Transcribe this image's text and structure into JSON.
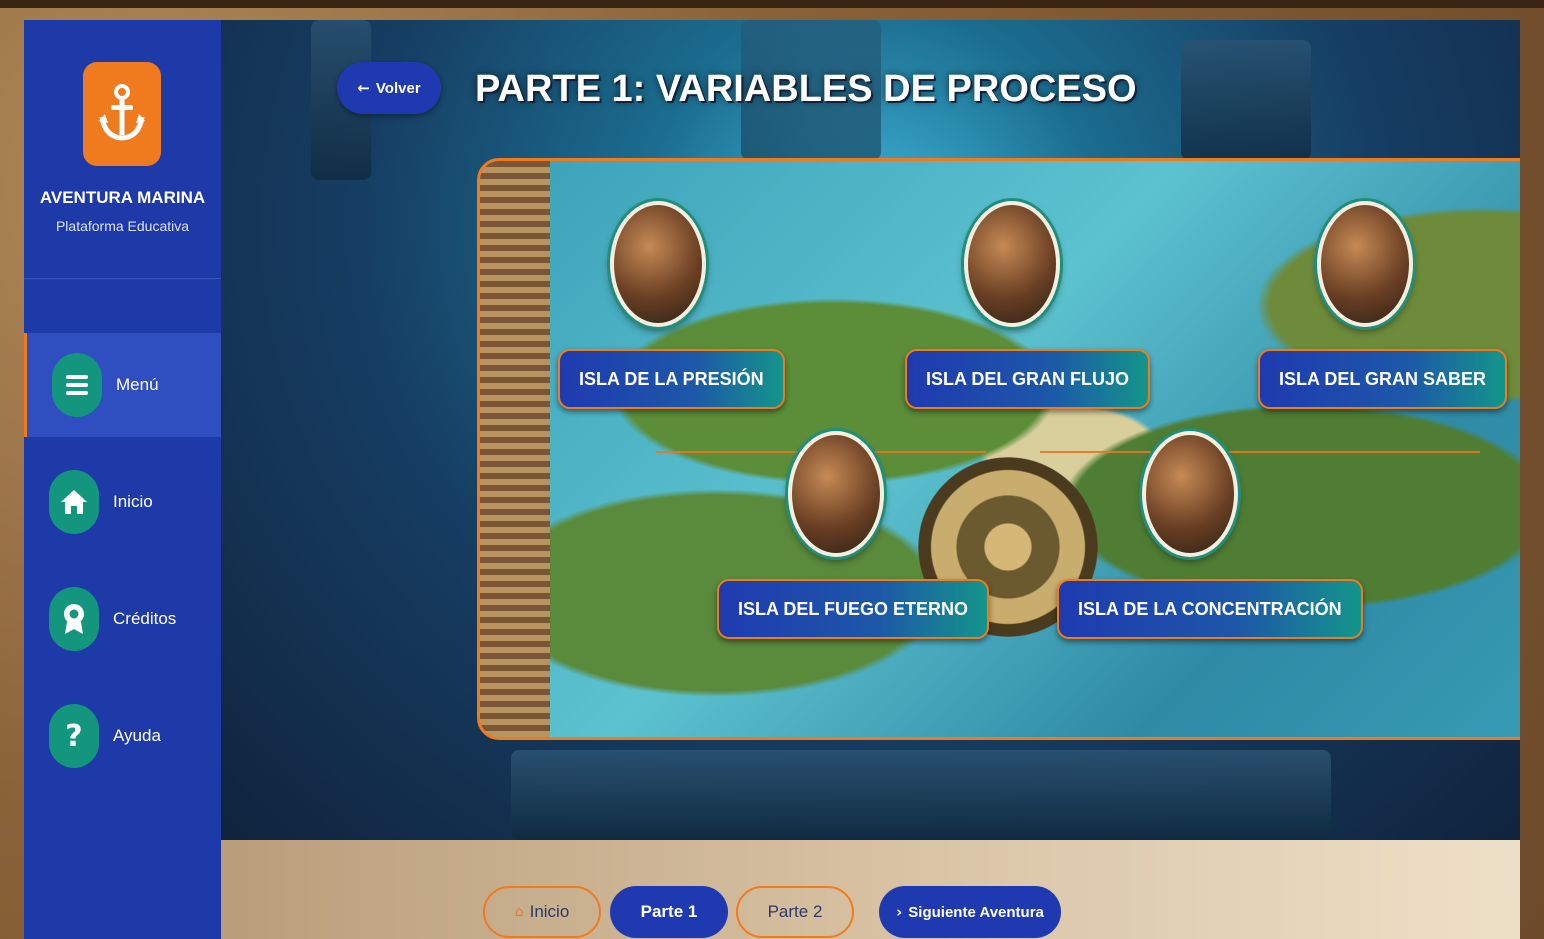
{
  "brand": {
    "title": "AVENTURA MARINA",
    "subtitle": "Plataforma Educativa",
    "logo_icon": "anchor-icon",
    "logo_color": "#f07a1e"
  },
  "sidebar": {
    "items": [
      {
        "label": "Menú",
        "icon": "menu-icon",
        "active": true
      },
      {
        "label": "Inicio",
        "icon": "home-icon",
        "active": false
      },
      {
        "label": "Créditos",
        "icon": "award-icon",
        "active": false
      },
      {
        "label": "Ayuda",
        "icon": "help-icon",
        "active": false
      }
    ]
  },
  "header": {
    "back_label": "Volver",
    "title": "PARTE 1: VARIABLES DE PROCESO"
  },
  "islands": [
    {
      "label": "ISLA DE LA PRESIÓN"
    },
    {
      "label": "ISLA DEL GRAN FLUJO"
    },
    {
      "label": "ISLA DEL GRAN SABER"
    },
    {
      "label": "ISLA DEL FUEGO ETERNO"
    },
    {
      "label": "ISLA DE LA CONCENTRACIÓN"
    }
  ],
  "footer": {
    "home_label": "Inicio",
    "part1_label": "Parte 1",
    "part2_label": "Parte 2",
    "next_label": "Siguiente Aventura"
  },
  "colors": {
    "sidebar": "#1e3aa8",
    "accent": "#f07a1e",
    "teal": "#13957e",
    "primary_button": "#1f3ab0"
  }
}
